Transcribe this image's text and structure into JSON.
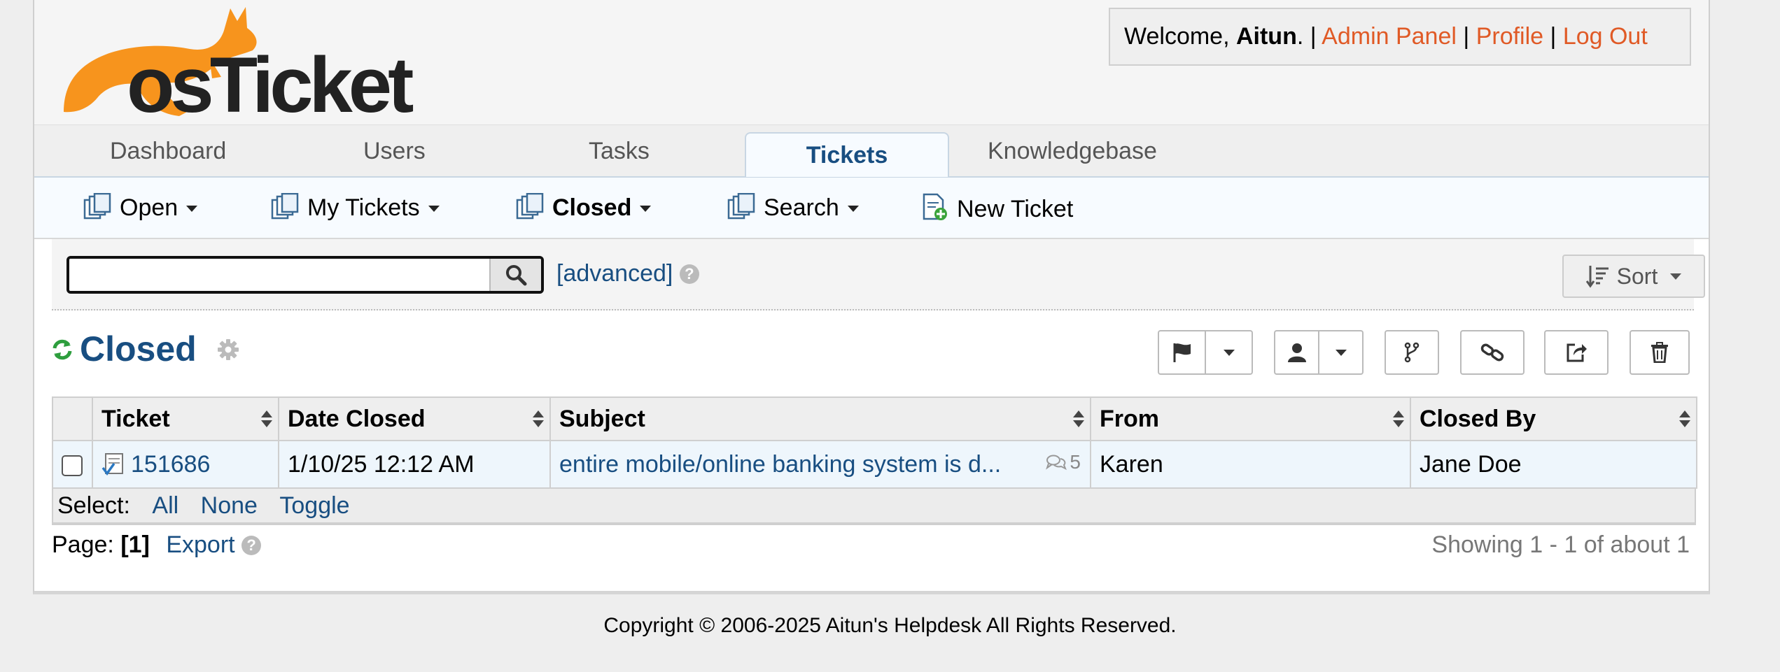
{
  "header": {
    "logo_text": "osTicket",
    "welcome_prefix": "Welcome,",
    "username": "Aitun",
    "welcome_suffix": ". |",
    "admin_panel": "Admin Panel",
    "profile": "Profile",
    "logout": "Log Out",
    "sep": "|"
  },
  "nav": {
    "tabs": [
      {
        "label": "Dashboard"
      },
      {
        "label": "Users"
      },
      {
        "label": "Tasks"
      },
      {
        "label": "Tickets"
      },
      {
        "label": "Knowledgebase"
      }
    ]
  },
  "subnav": {
    "items": [
      {
        "label": "Open"
      },
      {
        "label": "My Tickets"
      },
      {
        "label": "Closed"
      },
      {
        "label": "Search"
      },
      {
        "label": "New Ticket"
      }
    ]
  },
  "search": {
    "value": "",
    "placeholder": "",
    "advanced_label": "[advanced]",
    "help_glyph": "?",
    "sort_label": "Sort"
  },
  "queue": {
    "title": "Closed"
  },
  "table": {
    "headers": [
      "Ticket",
      "Date Closed",
      "Subject",
      "From",
      "Closed By"
    ],
    "rows": [
      {
        "ticket": "151686",
        "date_closed": "1/10/25 12:12 AM",
        "subject": "entire mobile/online banking system is d...",
        "thread_count": "5",
        "from": "Karen",
        "closed_by": "Jane Doe"
      }
    ]
  },
  "select": {
    "label": "Select:",
    "all": "All",
    "none": "None",
    "toggle": "Toggle"
  },
  "pager": {
    "label": "Page:",
    "current": "[1]",
    "export": "Export",
    "help_glyph": "?",
    "showing": "Showing 1 - 1 of about 1"
  },
  "footer": {
    "copyright": "Copyright © 2006-2025 Aitun's Helpdesk All Rights Reserved."
  },
  "colors": {
    "brand_blue": "#184e81",
    "link_orange": "#e05a26",
    "logo_orange": "#f7941d",
    "refresh_green": "#2e9e3e"
  }
}
